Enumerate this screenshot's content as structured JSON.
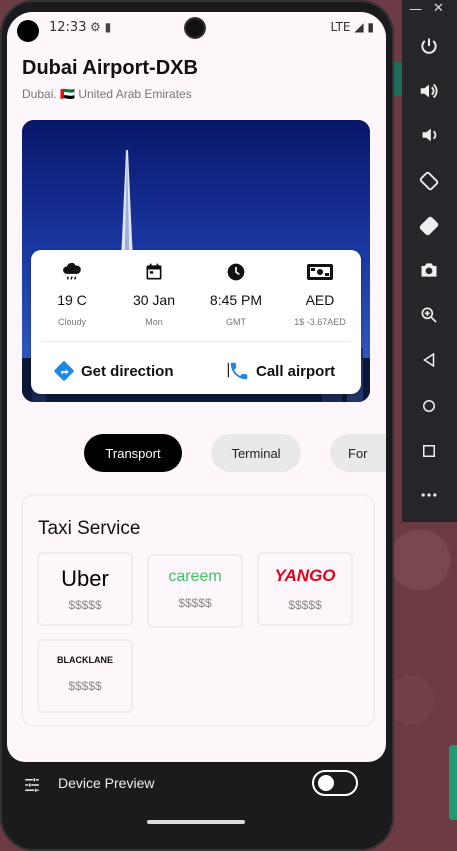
{
  "status_bar": {
    "time": "12:33",
    "network": "LTE"
  },
  "header": {
    "title": "Dubai Airport-DXB",
    "subtitle_city": "Dubai.",
    "subtitle_flag": "🇦🇪",
    "subtitle_country": "United Arab Emirates"
  },
  "info": {
    "weather": {
      "icon": "cloud-rain-icon",
      "value": "19 C",
      "label": "Cloudy"
    },
    "date": {
      "icon": "calendar-icon",
      "value": "30 Jan",
      "label": "Mon"
    },
    "time": {
      "icon": "clock-icon",
      "value": "8:45 PM",
      "label": "GMT"
    },
    "currency": {
      "icon": "money-icon",
      "value": "AED",
      "label": "1$ -3.67AED"
    }
  },
  "actions": {
    "direction": "Get direction",
    "separator": "|",
    "call": "Call airport"
  },
  "tabs": [
    "Transport",
    "Terminal",
    "For"
  ],
  "taxi": {
    "title": "Taxi Service",
    "providers": [
      {
        "name": "Uber",
        "price": "$$$$$"
      },
      {
        "name": "careem",
        "price": "$$$$$"
      },
      {
        "name": "YANGO",
        "price": "$$$$$"
      },
      {
        "name": "BLACKLANE",
        "price": "$$$$$"
      }
    ]
  },
  "device_preview": {
    "label": "Device Preview"
  },
  "colors": {
    "accent_blue": "#1e88e5",
    "careem_green": "#3cc464",
    "yango_red": "#e3001b",
    "tab_active_bg": "#000000"
  }
}
